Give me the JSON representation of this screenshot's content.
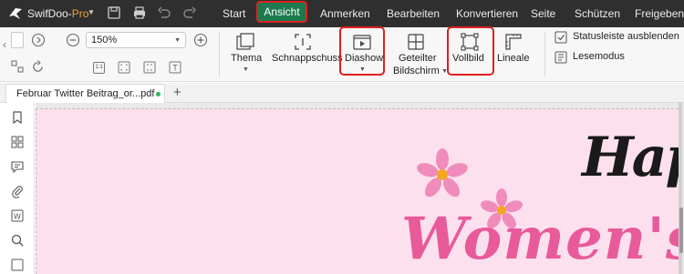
{
  "app": {
    "name_main": "SwifDoo-",
    "name_accent": "Pro"
  },
  "menu": {
    "items": [
      "Start",
      "Ansicht",
      "Anmerken",
      "Bearbeiten",
      "Konvertieren",
      "Seite",
      "Schützen",
      "Freigeben"
    ],
    "active": "Ansicht"
  },
  "ribbon": {
    "zoom_value": "150%",
    "thema": "Thema",
    "schnappschuss": "Schnappschuss",
    "diashow": "Diashow",
    "geteilter_line1": "Geteilter",
    "geteilter_line2": "Bildschirm",
    "vollbild": "Vollbild",
    "lineale": "Lineale",
    "statusleiste": "Statusleiste ausblenden",
    "lesemodus": "Lesemodus",
    "fit_1_1": "1:1"
  },
  "tabs": {
    "document": "Februar Twitter Beitrag_or...pdf"
  },
  "page": {
    "line1": "Happ",
    "line2": "Women's D"
  },
  "colors": {
    "menubar": "#2f2f2f",
    "active_tab": "#1d7a4e",
    "highlight": "#e02020",
    "page_bg": "#fde0ee",
    "flower_petal": "#f08cbc",
    "flower_center": "#f5a623",
    "title_pink": "#e85a9a"
  }
}
